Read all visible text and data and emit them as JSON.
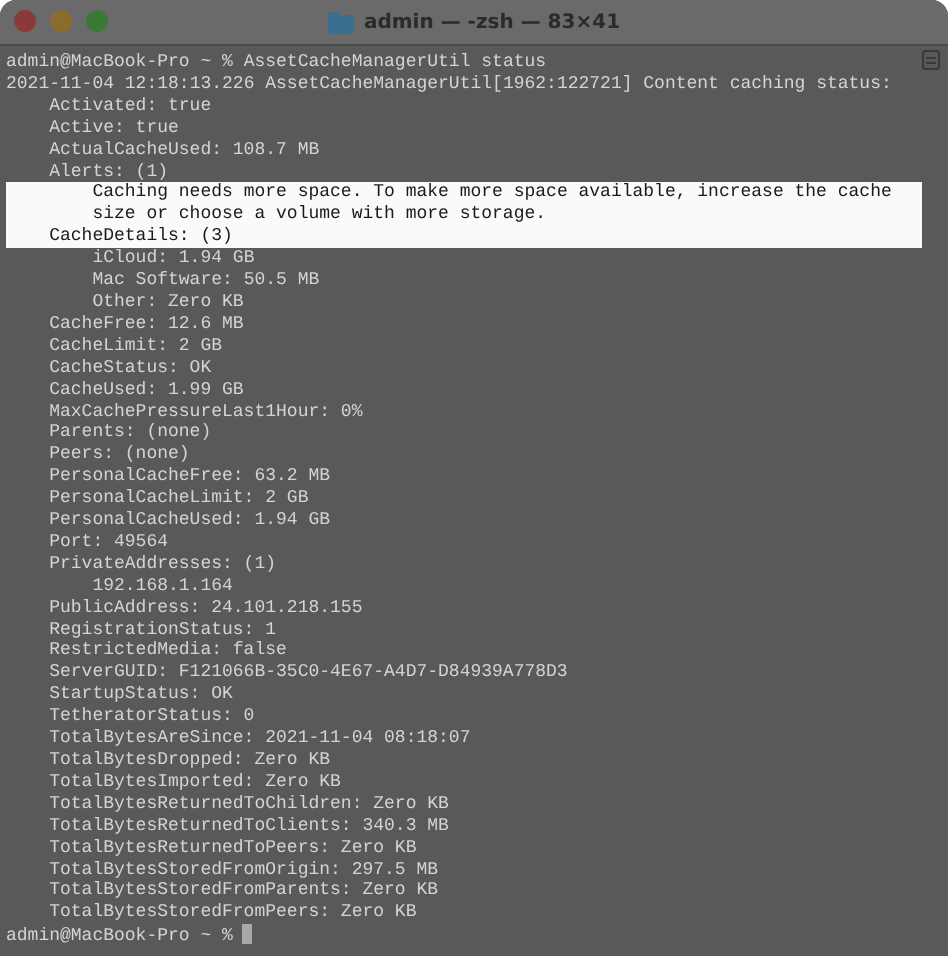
{
  "window": {
    "title": "admin — -zsh — 83×41"
  },
  "terminal": {
    "cursor": true,
    "lines": [
      {
        "text": "admin@MacBook-Pro ~ % AssetCacheManagerUtil status",
        "highlighted": false
      },
      {
        "text": "2021-11-04 12:18:13.226 AssetCacheManagerUtil[1962:122721] Content caching status:",
        "highlighted": false,
        "children": [
          {
            "text": "Activated: true",
            "highlighted": false
          },
          {
            "text": "Active: true",
            "highlighted": false
          },
          {
            "text": "ActualCacheUsed: 108.7 MB",
            "highlighted": false
          },
          {
            "text": "Alerts: (1)",
            "highlighted": false,
            "children": [
              {
                "text": "Caching needs more space. To make more space available, increase the cache size or choose a volume with more storage.",
                "highlighted": true
              }
            ]
          },
          {
            "text": "CacheDetails: (3)",
            "highlighted": true,
            "children": [
              {
                "text": "iCloud: 1.94 GB",
                "highlighted": false
              },
              {
                "text": "Mac Software: 50.5 MB",
                "highlighted": false
              },
              {
                "text": "Other: Zero KB",
                "highlighted": false
              }
            ]
          },
          {
            "text": "CacheFree: 12.6 MB",
            "highlighted": false
          },
          {
            "text": "CacheLimit: 2 GB",
            "highlighted": false
          },
          {
            "text": "CacheStatus: OK",
            "highlighted": false
          },
          {
            "text": "CacheUsed: 1.99 GB",
            "highlighted": false
          },
          {
            "text": "MaxCachePressureLast1Hour: 0%",
            "highlighted": false
          },
          {
            "text": "Parents: (none)",
            "highlighted": false
          },
          {
            "text": "Peers: (none)",
            "highlighted": false
          },
          {
            "text": "PersonalCacheFree: 63.2 MB",
            "highlighted": false
          },
          {
            "text": "PersonalCacheLimit: 2 GB",
            "highlighted": false
          },
          {
            "text": "PersonalCacheUsed: 1.94 GB",
            "highlighted": false
          },
          {
            "text": "Port: 49564",
            "highlighted": false
          },
          {
            "text": "PrivateAddresses: (1)",
            "highlighted": false,
            "children": [
              {
                "text": "192.168.1.164",
                "highlighted": false
              }
            ]
          },
          {
            "text": "PublicAddress: 24.101.218.155",
            "highlighted": false
          },
          {
            "text": "RegistrationStatus: 1",
            "highlighted": false
          },
          {
            "text": "RestrictedMedia: false",
            "highlighted": false
          },
          {
            "text": "ServerGUID: F121066B-35C0-4E67-A4D7-D84939A778D3",
            "highlighted": false
          },
          {
            "text": "StartupStatus: OK",
            "highlighted": false
          },
          {
            "text": "TetheratorStatus: 0",
            "highlighted": false
          },
          {
            "text": "TotalBytesAreSince: 2021-11-04 08:18:07",
            "highlighted": false
          },
          {
            "text": "TotalBytesDropped: Zero KB",
            "highlighted": false
          },
          {
            "text": "TotalBytesImported: Zero KB",
            "highlighted": false
          },
          {
            "text": "TotalBytesReturnedToChildren: Zero KB",
            "highlighted": false
          },
          {
            "text": "TotalBytesReturnedToClients: 340.3 MB",
            "highlighted": false
          },
          {
            "text": "TotalBytesReturnedToPeers: Zero KB",
            "highlighted": false
          },
          {
            "text": "TotalBytesStoredFromOrigin: 297.5 MB",
            "highlighted": false
          },
          {
            "text": "TotalBytesStoredFromParents: Zero KB",
            "highlighted": false
          },
          {
            "text": "TotalBytesStoredFromPeers: Zero KB",
            "highlighted": false
          }
        ]
      },
      {
        "text": "admin@MacBook-Pro ~ %",
        "highlighted": false
      }
    ]
  }
}
